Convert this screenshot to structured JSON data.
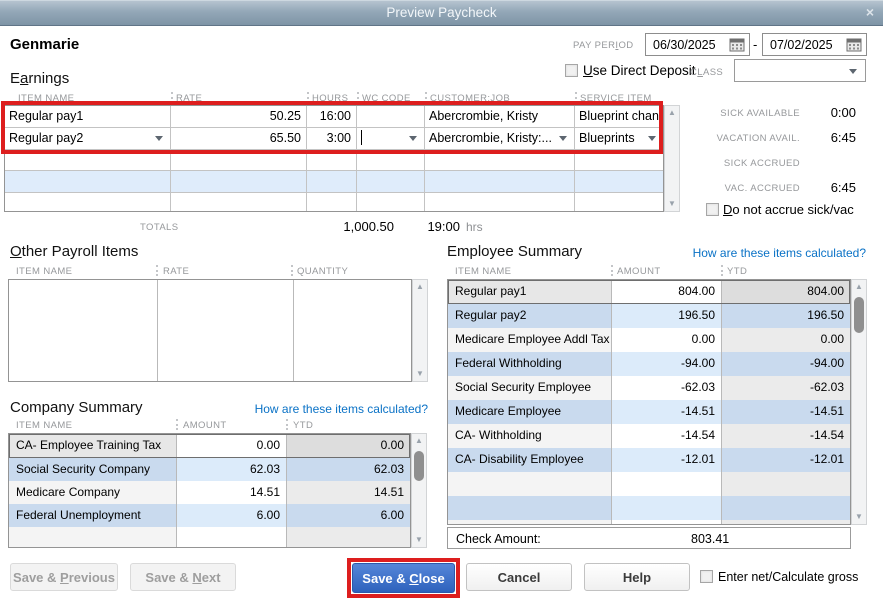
{
  "titlebar": {
    "title": "Preview Paycheck",
    "close": "×"
  },
  "employee_name": "Genmarie",
  "pay_period": {
    "label": {
      "pre": "PAY PER",
      "key": "I",
      "post": "OD"
    },
    "start": "06/30/2025",
    "dash": "-",
    "end": "07/02/2025"
  },
  "direct_deposit": {
    "label": {
      "pre": "",
      "key": "U",
      "post": "se Direct Deposit"
    }
  },
  "class_field": {
    "label": {
      "pre": "C",
      "key": "L",
      "post": "ASS"
    },
    "value": ""
  },
  "earnings": {
    "title": {
      "pre": "E",
      "key": "a",
      "post": "rnings"
    },
    "headers": {
      "item": "ITEM NAME",
      "rate": "RATE",
      "hours": "HOURS",
      "wc": "WC CODE",
      "customer": "CUSTOMER:JOB",
      "service": "SERVICE ITEM"
    },
    "rows": [
      {
        "item": "Regular pay1",
        "rate": "50.25",
        "hours": "16:00",
        "wc": "",
        "customer": "Abercrombie, Kristy",
        "service": "Blueprint chang..."
      },
      {
        "item": "Regular pay2",
        "rate": "65.50",
        "hours": "3:00",
        "wc": "",
        "customer": "Abercrombie, Kristy:...",
        "service": "Blueprints"
      }
    ],
    "totals_label": "TOTALS",
    "total_rate": "1,000.50",
    "total_hours": "19:00",
    "hours_unit": "hrs"
  },
  "accruals": {
    "sick_available_label": "SICK AVAILABLE",
    "sick_available": "0:00",
    "vacation_avail_label": "VACATION AVAIL.",
    "vacation_avail": "6:45",
    "sick_accrued_label": "SICK ACCRUED",
    "sick_accrued": "",
    "vac_accrued_label": "VAC. ACCRUED",
    "vac_accrued": "6:45",
    "do_not_accrue_label": {
      "pre": "",
      "key": "D",
      "post": "o not accrue sick/vac"
    }
  },
  "other_payroll": {
    "title": {
      "pre": "",
      "key": "O",
      "post": "ther Payroll Items"
    },
    "headers": {
      "item": "ITEM NAME",
      "rate": "RATE",
      "quantity": "QUANTITY"
    }
  },
  "company_summary": {
    "title": "Company Summary",
    "link": "How are these items calculated?",
    "headers": {
      "item": "ITEM NAME",
      "amount": "AMOUNT",
      "ytd": "YTD"
    },
    "rows": [
      {
        "item": "CA- Employee Training Tax",
        "amount": "0.00",
        "ytd": "0.00"
      },
      {
        "item": "Social Security Company",
        "amount": "62.03",
        "ytd": "62.03"
      },
      {
        "item": "Medicare Company",
        "amount": "14.51",
        "ytd": "14.51"
      },
      {
        "item": "Federal Unemployment",
        "amount": "6.00",
        "ytd": "6.00"
      }
    ]
  },
  "employee_summary": {
    "title": "Employee Summary",
    "link": "How are these items calculated?",
    "headers": {
      "item": "ITEM NAME",
      "amount": "AMOUNT",
      "ytd": "YTD"
    },
    "rows": [
      {
        "item": "Regular pay1",
        "amount": "804.00",
        "ytd": "804.00"
      },
      {
        "item": "Regular pay2",
        "amount": "196.50",
        "ytd": "196.50"
      },
      {
        "item": "Medicare Employee Addl Tax",
        "amount": "0.00",
        "ytd": "0.00"
      },
      {
        "item": "Federal Withholding",
        "amount": "-94.00",
        "ytd": "-94.00"
      },
      {
        "item": "Social Security Employee",
        "amount": "-62.03",
        "ytd": "-62.03"
      },
      {
        "item": "Medicare Employee",
        "amount": "-14.51",
        "ytd": "-14.51"
      },
      {
        "item": "CA- Withholding",
        "amount": "-14.54",
        "ytd": "-14.54"
      },
      {
        "item": "CA- Disability Employee",
        "amount": "-12.01",
        "ytd": "-12.01"
      }
    ],
    "check_amount_label": "Check Amount:",
    "check_amount": "803.41"
  },
  "buttons": {
    "save_previous": {
      "pre": "Save & ",
      "key": "P",
      "post": "revious"
    },
    "save_next": {
      "pre": "Save & ",
      "key": "N",
      "post": "ext"
    },
    "save_close": {
      "pre": "Save & ",
      "key": "C",
      "post": "lose"
    },
    "cancel": "Cancel",
    "help": "Help",
    "enter_net_label": {
      "pre": "Enter net/Calculate ",
      "key": "g",
      "post": "ross"
    }
  },
  "colors": {
    "highlight_red": "#dd1e1e",
    "link_blue": "#0a72c6",
    "primary_blue": "#2e62bd",
    "row_blue": "#dcebfa",
    "titlebar_top": "#b9c6d2",
    "titlebar_bottom": "#7e94a6"
  }
}
